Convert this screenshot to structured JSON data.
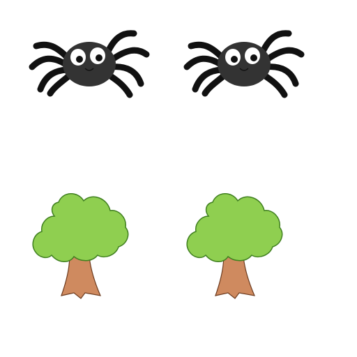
{
  "colors": {
    "background": "#ffffff",
    "spider_body": "#333333",
    "spider_legs": "#111111",
    "eye_white": "#ffffff",
    "pupil": "#111111",
    "tree_canopy": "#8fcf50",
    "tree_canopy_outline": "#3f7f1f",
    "tree_trunk": "#cf8a5f",
    "tree_trunk_outline": "#6b3a1e"
  },
  "figures": {
    "spiders": [
      {
        "icon": "spider-icon"
      },
      {
        "icon": "spider-icon"
      }
    ],
    "trees": [
      {
        "icon": "tree-icon"
      },
      {
        "icon": "tree-icon"
      }
    ]
  }
}
